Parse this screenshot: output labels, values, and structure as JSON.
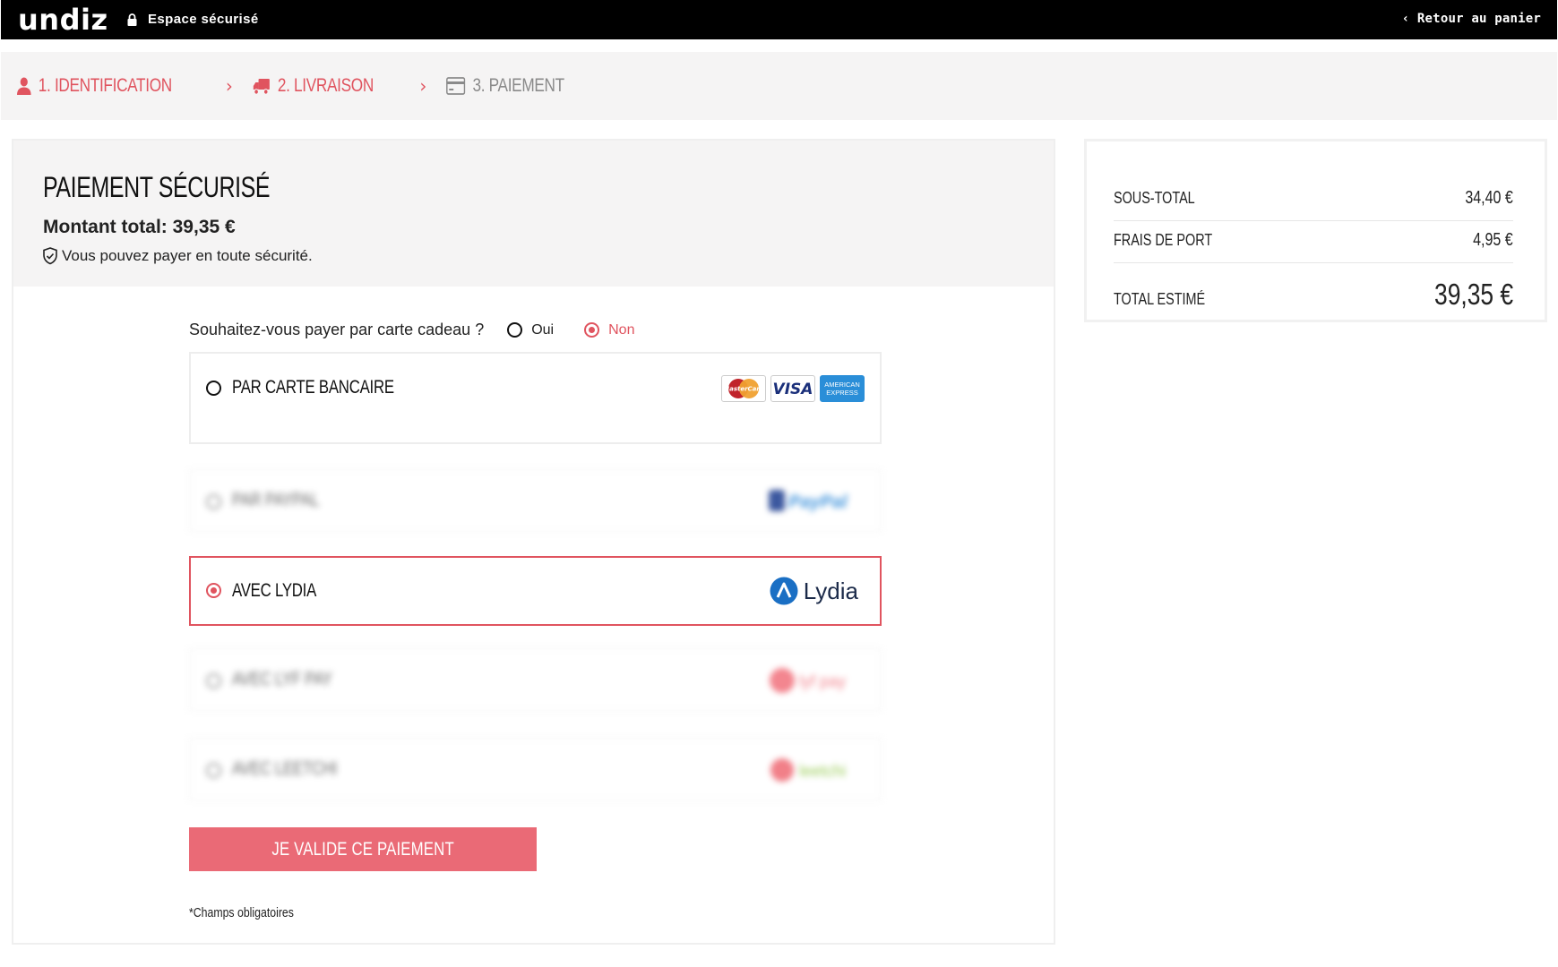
{
  "header": {
    "logo": "undiz",
    "secure_label": "Espace sécurisé",
    "back_label": "‹ Retour au panier"
  },
  "steps": [
    {
      "label": "1. IDENTIFICATION",
      "state": "active",
      "icon": "user-icon"
    },
    {
      "label": "2. LIVRAISON",
      "state": "active",
      "icon": "truck-icon"
    },
    {
      "label": "3. PAIEMENT",
      "state": "inactive",
      "icon": "credit-card-icon"
    }
  ],
  "payment": {
    "title": "PAIEMENT SÉCURISÉ",
    "amount_text": "Montant total: 39,35 €",
    "safe_text": "Vous pouvez payer en toute sécurité.",
    "gift_question": "Souhaitez-vous payer par carte cadeau ?",
    "gift_options": [
      {
        "label": "Oui",
        "selected": false
      },
      {
        "label": "Non",
        "selected": true
      }
    ],
    "methods": [
      {
        "label": "PAR CARTE BANCAIRE",
        "selected": false,
        "blurred": false,
        "logos": [
          "MasterCard",
          "VISA",
          "AMERICAN EXPRESS"
        ]
      },
      {
        "label": "PAR PAYPAL",
        "selected": false,
        "blurred": true,
        "logo": "PayPal"
      },
      {
        "label": "AVEC LYDIA",
        "selected": true,
        "blurred": false,
        "logo": "Lydia"
      },
      {
        "label": "AVEC LYF PAY",
        "selected": false,
        "blurred": true,
        "logo": "lyf pay"
      },
      {
        "label": "AVEC LEETCHI",
        "selected": false,
        "blurred": true,
        "logo": "leetchi"
      }
    ],
    "submit_label": "JE VALIDE CE PAIEMENT",
    "required_note": "*Champs obligatoires"
  },
  "summary": {
    "subtotal_label": "SOUS-TOTAL",
    "subtotal_value": "34,40 €",
    "shipping_label": "FRAIS DE PORT",
    "shipping_value": "4,95 €",
    "total_label": "TOTAL ESTIMÉ",
    "total_value": "39,35 €"
  },
  "colors": {
    "accent": "#e0545f",
    "button": "#ea6a76",
    "lydia_blue": "#1a6fc4"
  }
}
